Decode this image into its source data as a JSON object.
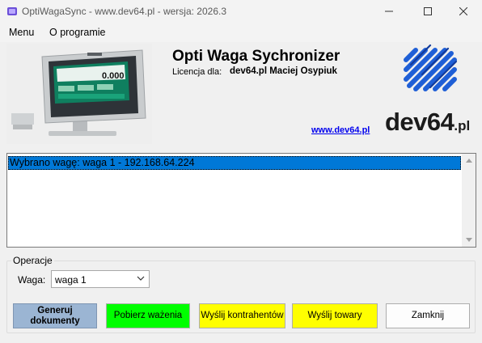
{
  "window": {
    "title": "OptiWagaSync - www.dev64.pl - wersja: 2026.3"
  },
  "menu": {
    "items": [
      "Menu",
      "O programie"
    ]
  },
  "header": {
    "app_name": "Opti Waga Sychronizer",
    "licence_label": "Licencja dla:",
    "licence_value": "dev64.pl Maciej Osypiuk",
    "link": "www.dev64.pl",
    "logo_text": "dev64",
    "logo_suffix": ".pl",
    "scale_display": "0.000"
  },
  "list": {
    "items": [
      "Wybrano wagę: waga 1 - 192.168.64.224"
    ]
  },
  "operations": {
    "legend": "Operacje",
    "scale_label": "Waga:",
    "scale_selected": "waga 1"
  },
  "buttons": {
    "generate": "Generuj dokumenty",
    "fetch": "Pobierz ważenia",
    "send_contractors": "Wyślij kontrahentów",
    "send_goods": "Wyślij towary",
    "close": "Zamknij"
  },
  "colors": {
    "selection": "#0078d7",
    "btn_generate": "#9bb5d3",
    "btn_fetch": "#00ff00",
    "btn_send": "#ffff00",
    "logo_blue": "#1f5fd6"
  },
  "icons": {
    "app": "scale-app-icon",
    "minimize": "minimize-icon",
    "maximize": "maximize-icon",
    "close": "close-icon"
  }
}
